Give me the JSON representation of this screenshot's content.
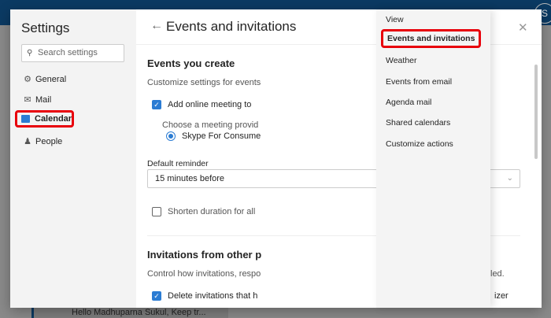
{
  "background": {
    "message_preview": "Hello Madhuparna Sukul, Keep tr...",
    "avatar_initial": "S"
  },
  "settings": {
    "title": "Settings",
    "search_placeholder": "Search settings",
    "nav": [
      {
        "label": "General",
        "icon": "gear-icon"
      },
      {
        "label": "Mail",
        "icon": "mail-icon"
      },
      {
        "label": "Calendar",
        "icon": "calendar-icon",
        "selected": true
      },
      {
        "label": "People",
        "icon": "people-icon"
      }
    ]
  },
  "page": {
    "title": "Events and invitations",
    "section1": {
      "heading": "Events you create",
      "desc": "Customize settings for events",
      "add_online_meeting": "Add online meeting to",
      "choose_provider": "Choose a meeting provid",
      "provider": "Skype For Consume",
      "default_reminder_label": "Default reminder",
      "default_reminder_value": "15 minutes before",
      "shorten_duration": "Shorten duration for all"
    },
    "section2": {
      "heading": "Invitations from other p",
      "desc": "Control how invitations, respo",
      "desc_tail": "led.",
      "delete_invitations": "Delete invitations that h",
      "delete_tail": "izer"
    }
  },
  "menu": [
    "View",
    "Events and invitations",
    "Weather",
    "Events from email",
    "Agenda mail",
    "Shared calendars",
    "Customize actions"
  ],
  "colors": {
    "accent": "#2b7cd3",
    "highlight": "#e8000b"
  }
}
